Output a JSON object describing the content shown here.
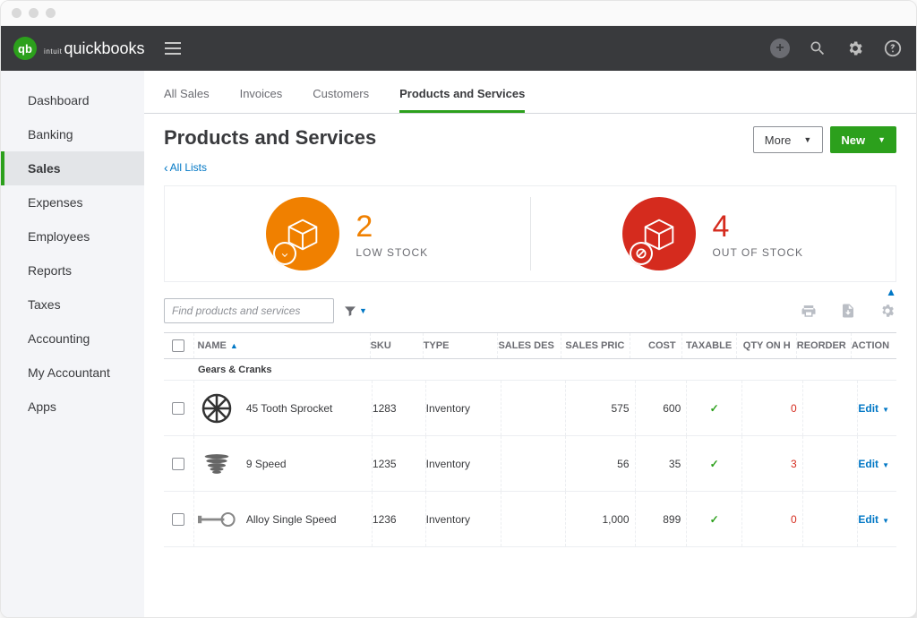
{
  "brand": {
    "sup": "intuit",
    "main": "quickbooks",
    "logo_text": "qb"
  },
  "sidebar": {
    "items": [
      "Dashboard",
      "Banking",
      "Sales",
      "Expenses",
      "Employees",
      "Reports",
      "Taxes",
      "Accounting",
      "My Accountant",
      "Apps"
    ],
    "active_index": 2
  },
  "tabs": {
    "items": [
      "All Sales",
      "Invoices",
      "Customers",
      "Products and Services"
    ],
    "active_index": 3
  },
  "page": {
    "title": "Products and Services",
    "all_lists": "All Lists",
    "more_btn": "More",
    "new_btn": "New"
  },
  "stats": {
    "low": {
      "count": "2",
      "label": "LOW STOCK"
    },
    "out": {
      "count": "4",
      "label": "OUT OF STOCK"
    }
  },
  "toolbar": {
    "search_placeholder": "Find products and services"
  },
  "table": {
    "headers": {
      "name": "NAME",
      "sku": "SKU",
      "type": "TYPE",
      "desc": "SALES DES",
      "price": "SALES PRIC",
      "cost": "COST",
      "tax": "TAXABLE",
      "qty": "QTY ON H",
      "reorder": "REORDER",
      "action": "ACTION"
    },
    "group": "Gears & Cranks",
    "rows": [
      {
        "name": "45 Tooth Sprocket",
        "sku": "1283",
        "type": "Inventory",
        "price": "575",
        "cost": "600",
        "tax": "✓",
        "qty": "0",
        "action": "Edit"
      },
      {
        "name": "9 Speed",
        "sku": "1235",
        "type": "Inventory",
        "price": "56",
        "cost": "35",
        "tax": "✓",
        "qty": "3",
        "action": "Edit"
      },
      {
        "name": "Alloy Single Speed",
        "sku": "1236",
        "type": "Inventory",
        "price": "1,000",
        "cost": "899",
        "tax": "✓",
        "qty": "0",
        "action": "Edit"
      }
    ]
  }
}
